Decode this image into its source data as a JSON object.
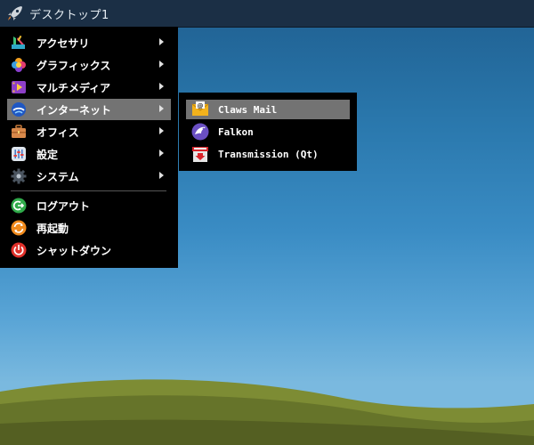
{
  "taskbar": {
    "launcher_icon": "rocket-icon",
    "desktop_label": "デスクトップ1"
  },
  "main_menu": {
    "items": [
      {
        "label": "アクセサリ",
        "icon": "accessories-icon",
        "submenu": true
      },
      {
        "label": "グラフィックス",
        "icon": "graphics-icon",
        "submenu": true
      },
      {
        "label": "マルチメディア",
        "icon": "multimedia-icon",
        "submenu": true
      },
      {
        "label": "インターネット",
        "icon": "internet-icon",
        "submenu": true,
        "active": true
      },
      {
        "label": "オフィス",
        "icon": "office-icon",
        "submenu": true
      },
      {
        "label": "設定",
        "icon": "settings-icon",
        "submenu": true
      },
      {
        "label": "システム",
        "icon": "system-icon",
        "submenu": true
      }
    ],
    "session_items": [
      {
        "label": "ログアウト",
        "icon": "logout-icon"
      },
      {
        "label": "再起動",
        "icon": "reboot-icon"
      },
      {
        "label": "シャットダウン",
        "icon": "shutdown-icon"
      }
    ]
  },
  "internet_submenu": {
    "items": [
      {
        "label": "Claws Mail",
        "icon": "claws-mail-icon",
        "active": true
      },
      {
        "label": "Falkon",
        "icon": "falkon-icon"
      },
      {
        "label": "Transmission (Qt)",
        "icon": "transmission-icon"
      }
    ]
  },
  "colors": {
    "taskbar": "#1b2f45",
    "menu_bg": "#000000",
    "highlight": "#737373",
    "sky": "#3a8cc4",
    "hill": "#6f7a2e"
  }
}
